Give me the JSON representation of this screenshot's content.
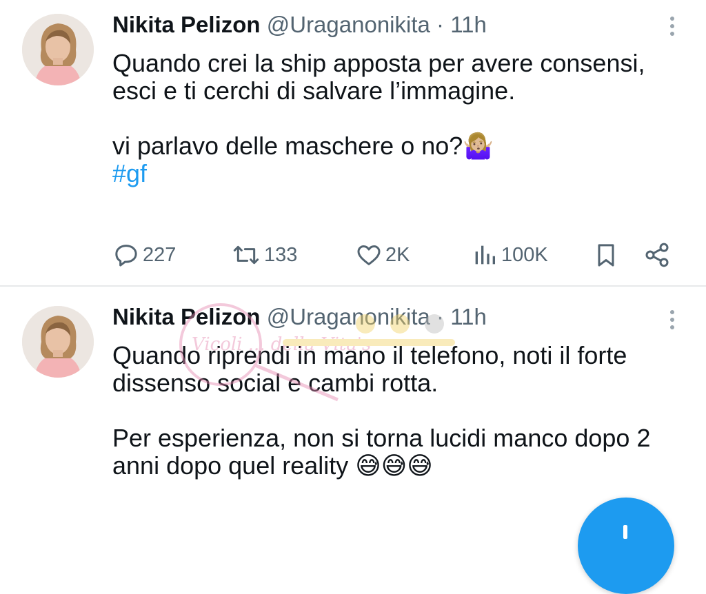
{
  "tweets": [
    {
      "author": {
        "name": "Nikita Pelizon",
        "handle": "@Uraganonikita",
        "separator": "·",
        "time": "11h"
      },
      "paragraphs": [
        "Quando crei la ship apposta per avere consensi, esci e ti cerchi di salvare l’immagine.",
        "vi parlavo delle maschere  o no?🤷🏼‍♀️"
      ],
      "hashtag": "#gf",
      "stats": {
        "replies": "227",
        "reposts": "133",
        "likes": "2K",
        "views": "100K"
      },
      "icons": [
        "reply-icon",
        "repost-icon",
        "like-icon",
        "views-icon",
        "bookmark-icon",
        "share-icon"
      ]
    },
    {
      "author": {
        "name": "Nikita Pelizon",
        "handle": "@Uraganonikita",
        "separator": "·",
        "time": "11h"
      },
      "paragraphs": [
        "Quando riprendi in mano il telefono, noti il forte dissenso social e cambi rotta.",
        "Per esperienza, non si torna lucidi manco dopo 2 anni dopo quel reality 😅😅😅"
      ]
    }
  ],
  "watermark": {
    "text": "Vicoli ... della Vita's"
  },
  "colors": {
    "link": "#1d9bf0",
    "muted": "#536471",
    "text": "#0f1419",
    "divider": "#e7e9ea"
  }
}
